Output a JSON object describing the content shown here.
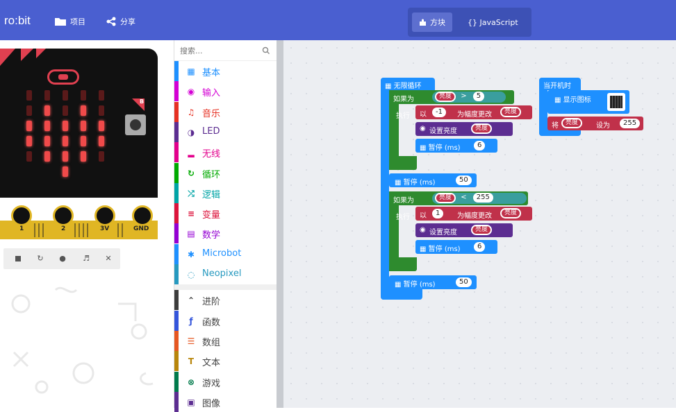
{
  "topbar": {
    "logo": "ro:bit",
    "project_label": "项目",
    "share_label": "分享",
    "mode_blocks": "方块",
    "mode_js": "{} JavaScript"
  },
  "simulator": {
    "pins": [
      "1",
      "2",
      "3V",
      "GND"
    ],
    "button_b": "B",
    "controls": [
      "stop",
      "restart",
      "slowmo",
      "mute",
      "fullscreen"
    ]
  },
  "palette": {
    "search_placeholder": "搜索...",
    "categories": [
      {
        "label": "基本",
        "icon": "grid-icon",
        "color": "#1e90ff"
      },
      {
        "label": "输入",
        "icon": "input-icon",
        "color": "#d400d4"
      },
      {
        "label": "音乐",
        "icon": "headphones-icon",
        "color": "#e63022"
      },
      {
        "label": "LED",
        "icon": "toggle-icon",
        "color": "#5c2d91"
      },
      {
        "label": "无线",
        "icon": "signal-icon",
        "color": "#e3008c"
      },
      {
        "label": "循环",
        "icon": "loop-icon",
        "color": "#00aa00"
      },
      {
        "label": "逻辑",
        "icon": "shuffle-icon",
        "color": "#00a4a6"
      },
      {
        "label": "变量",
        "icon": "lines-icon",
        "color": "#dc143c"
      },
      {
        "label": "数学",
        "icon": "calculator-icon",
        "color": "#9400d3"
      },
      {
        "label": "Microbot",
        "icon": "gear-icon",
        "color": "#1e90ff"
      },
      {
        "label": "Neopixel",
        "icon": "ring-icon",
        "color": "#2699bf"
      },
      {
        "label": "进阶",
        "icon": "chevron-up-icon",
        "color": "#3c3c3c"
      },
      {
        "label": "函数",
        "icon": "function-icon",
        "color": "#3455db"
      },
      {
        "label": "数组",
        "icon": "list-icon",
        "color": "#e65722"
      },
      {
        "label": "文本",
        "icon": "text-icon",
        "color": "#b8860b"
      },
      {
        "label": "游戏",
        "icon": "gamepad-icon",
        "color": "#007a4b"
      },
      {
        "label": "图像",
        "icon": "image-icon",
        "color": "#5c2d91"
      }
    ]
  },
  "blocks": {
    "forever": "无限循环",
    "on_start": "当开机时",
    "if_label": "如果为",
    "then_label": "执行",
    "brightness_var": "亮度",
    "cmp_gt": ">",
    "cmp_lt": "<",
    "num_5": "5",
    "num_255": "255",
    "num_neg1": "-1",
    "num_1": "1",
    "by_label": "以",
    "change_label": "为幅度更改",
    "set_brightness": "设置亮度",
    "pause_label": "暂停 (ms)",
    "pause_6": "6",
    "pause_50": "50",
    "show_icon": "显示图标",
    "set_label": "将",
    "to_label": "设为",
    "set_value": "255"
  },
  "colors": {
    "topbar": "#4a5fd0",
    "loop_blue": "#1e90ff",
    "loop_green": "#2e8b2e",
    "logic_teal": "#3a9e9e",
    "variable_red": "#c0314a",
    "led_purple": "#5c2d91",
    "gold": "#e0b624"
  }
}
